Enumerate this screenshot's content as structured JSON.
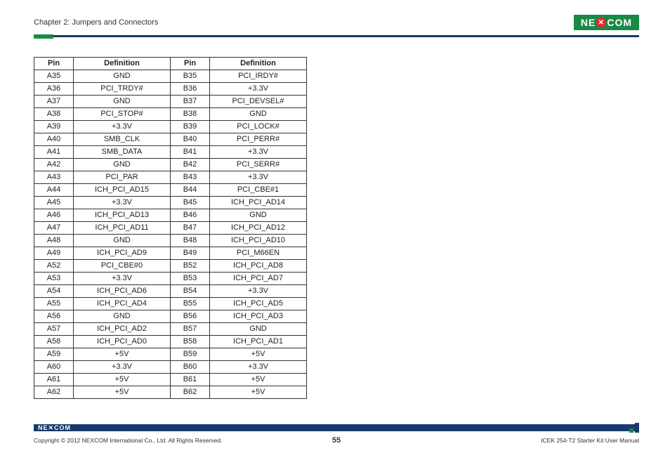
{
  "header": {
    "chapter": "Chapter 2: Jumpers and Connectors",
    "logo_pre": "NE",
    "logo_x": "✕",
    "logo_post": "COM"
  },
  "table": {
    "headers": [
      "Pin",
      "Definition",
      "Pin",
      "Definition"
    ],
    "rows": [
      [
        "A35",
        "GND",
        "B35",
        "PCI_IRDY#"
      ],
      [
        "A36",
        "PCI_TRDY#",
        "B36",
        "+3.3V"
      ],
      [
        "A37",
        "GND",
        "B37",
        "PCI_DEVSEL#"
      ],
      [
        "A38",
        "PCI_STOP#",
        "B38",
        "GND"
      ],
      [
        "A39",
        "+3.3V",
        "B39",
        "PCI_LOCK#"
      ],
      [
        "A40",
        "SMB_CLK",
        "B40",
        "PCI_PERR#"
      ],
      [
        "A41",
        "SMB_DATA",
        "B41",
        "+3.3V"
      ],
      [
        "A42",
        "GND",
        "B42",
        "PCI_SERR#"
      ],
      [
        "A43",
        "PCI_PAR",
        "B43",
        "+3.3V"
      ],
      [
        "A44",
        "ICH_PCI_AD15",
        "B44",
        "PCI_CBE#1"
      ],
      [
        "A45",
        "+3.3V",
        "B45",
        "ICH_PCI_AD14"
      ],
      [
        "A46",
        "ICH_PCI_AD13",
        "B46",
        "GND"
      ],
      [
        "A47",
        "ICH_PCI_AD11",
        "B47",
        "ICH_PCI_AD12"
      ],
      [
        "A48",
        "GND",
        "B48",
        "ICH_PCI_AD10"
      ],
      [
        "A49",
        "ICH_PCI_AD9",
        "B49",
        "PCI_M66EN"
      ],
      [
        "A52",
        "PCI_CBE#0",
        "B52",
        "ICH_PCI_AD8"
      ],
      [
        "A53",
        "+3.3V",
        "B53",
        "ICH_PCI_AD7"
      ],
      [
        "A54",
        "ICH_PCI_AD6",
        "B54",
        "+3.3V"
      ],
      [
        "A55",
        "ICH_PCI_AD4",
        "B55",
        "ICH_PCI_AD5"
      ],
      [
        "A56",
        "GND",
        "B56",
        "ICH_PCI_AD3"
      ],
      [
        "A57",
        "ICH_PCI_AD2",
        "B57",
        "GND"
      ],
      [
        "A58",
        "ICH_PCI_AD0",
        "B58",
        "ICH_PCI_AD1"
      ],
      [
        "A59",
        "+5V",
        "B59",
        "+5V"
      ],
      [
        "A60",
        "+3.3V",
        "B60",
        "+3.3V"
      ],
      [
        "A61",
        "+5V",
        "B61",
        "+5V"
      ],
      [
        "A62",
        "+5V",
        "B62",
        "+5V"
      ]
    ]
  },
  "footer": {
    "copyright": "Copyright © 2012 NEXCOM International Co., Ltd. All Rights Reserved.",
    "page_number": "55",
    "doc_title": "ICEK 254-T2 Starter Kit User Manual",
    "logo_small": "NE✕COM"
  }
}
